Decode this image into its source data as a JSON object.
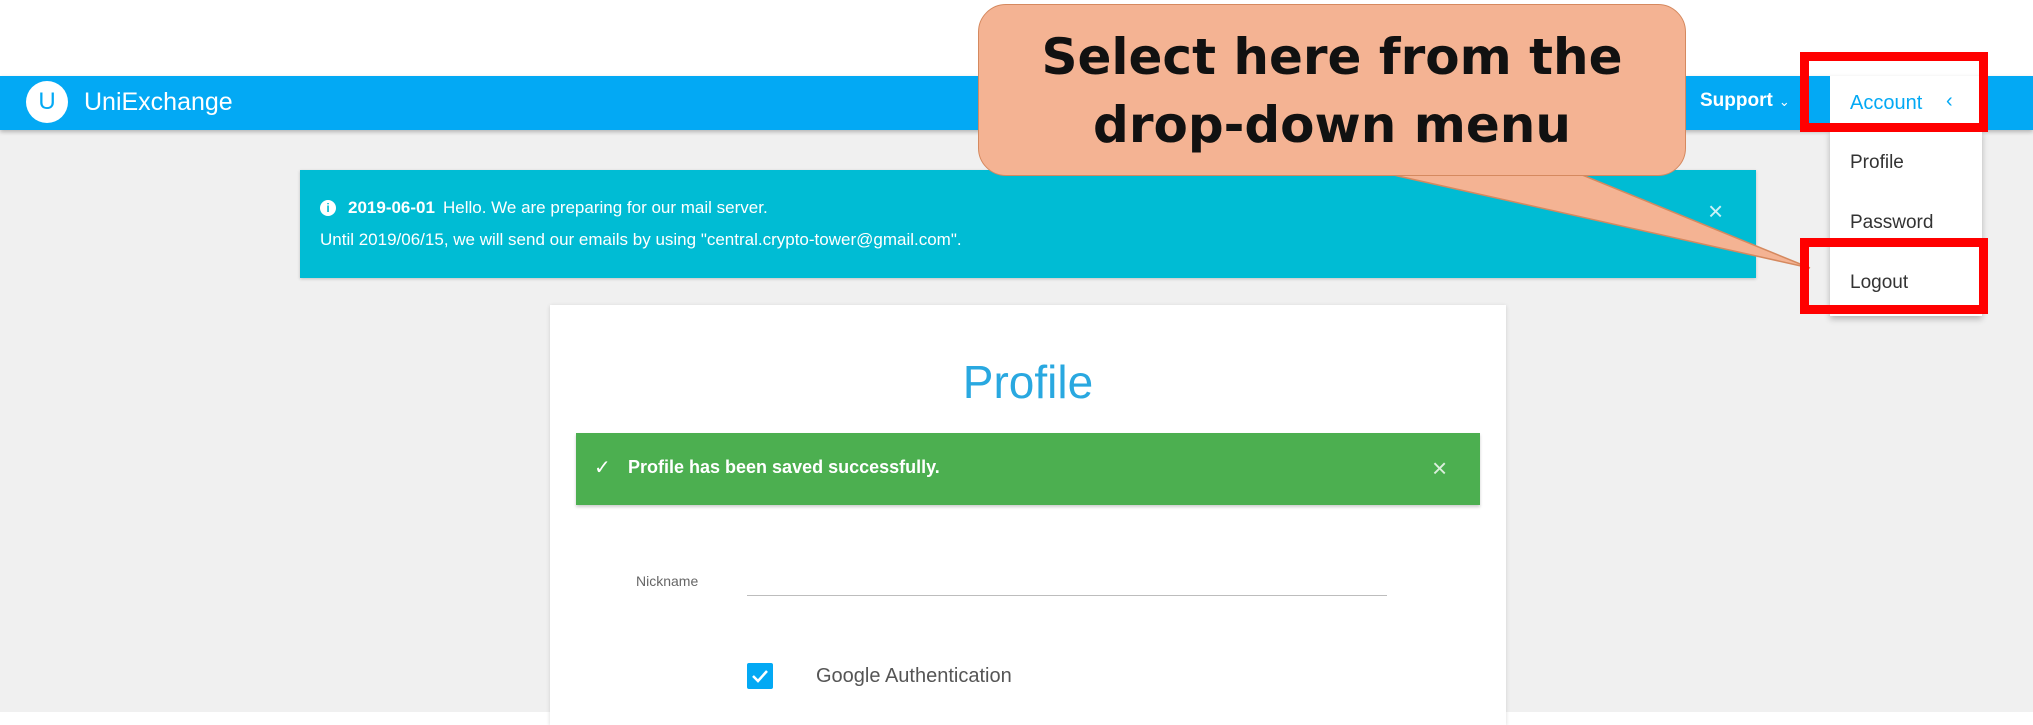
{
  "navbar": {
    "logo_letter": "U",
    "brand": "UniExchange",
    "support_label": "Support",
    "support_chevron": "⌄",
    "account_label": "Account",
    "account_chevron": "‹",
    "color": "#03a9f4"
  },
  "account_menu": {
    "items": [
      {
        "label": "Profile"
      },
      {
        "label": "Password"
      },
      {
        "label": "Logout"
      }
    ]
  },
  "notice": {
    "icon": "info-icon",
    "date": "2019-06-01",
    "line1": "Hello. We are preparing for our mail server.",
    "line2": "Until 2019/06/15, we will send our emails by using \"central.crypto-tower@gmail.com\".",
    "close": "×",
    "color": "#00bcd4"
  },
  "profile": {
    "title": "Profile",
    "success_message": "Profile has been saved successfully.",
    "success_icon": "✓",
    "success_close": "×",
    "success_color": "#4caf50",
    "nickname_label": "Nickname",
    "nickname_value": "",
    "google_auth_label": "Google Authentication",
    "google_auth_checked": true
  },
  "annotation": {
    "callout_line1": "Select here from the",
    "callout_line2": "drop-down menu",
    "highlight_color": "#ff0000",
    "callout_color": "#f4b393"
  }
}
